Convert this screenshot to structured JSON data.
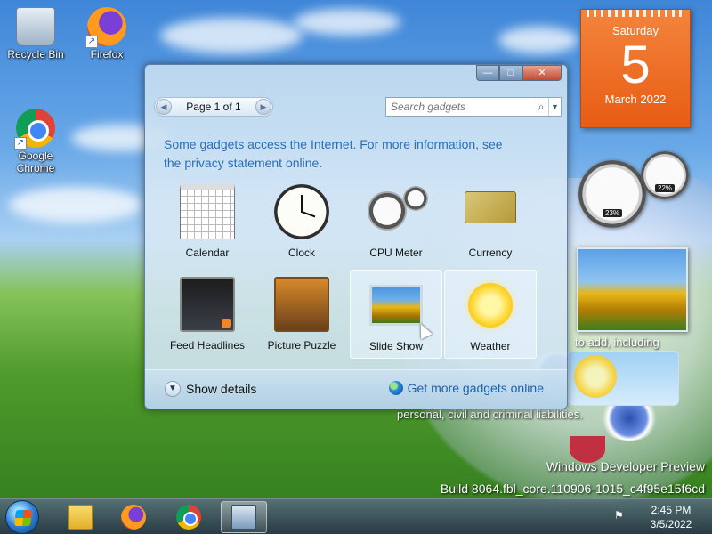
{
  "desktop": {
    "icons": [
      {
        "label": "Recycle Bin"
      },
      {
        "label": "Firefox"
      },
      {
        "label": "Google Chrome"
      }
    ],
    "overlay_text": {
      "line1": "to add, including",
      "line2": "personal, civil and criminal liabilities."
    },
    "watermark": {
      "line1": "Windows Developer Preview",
      "line2": "Build 8064.fbl_core.110906-1015_c4f95e15f6cd"
    }
  },
  "calendar_gadget": {
    "day_name": "Saturday",
    "day_number": "5",
    "month_year": "March 2022"
  },
  "cpu_meter_gadget": {
    "cpu_pct": "23%",
    "mem_pct": "22%"
  },
  "gallery": {
    "pager": {
      "text": "Page 1 of 1",
      "prev_icon": "chevron-left",
      "next_icon": "chevron-right"
    },
    "search": {
      "placeholder": "Search gadgets",
      "icon": "search-icon",
      "dropdown_icon": "chevron-down-icon"
    },
    "notice": {
      "text1": "Some gadgets access the Internet.  For more information, see",
      "text2": "the privacy statement online."
    },
    "gadgets": [
      {
        "label": "Calendar"
      },
      {
        "label": "Clock"
      },
      {
        "label": "CPU Meter"
      },
      {
        "label": "Currency"
      },
      {
        "label": "Feed Headlines"
      },
      {
        "label": "Picture Puzzle"
      },
      {
        "label": "Slide Show"
      },
      {
        "label": "Weather"
      }
    ],
    "details_label": "Show details",
    "get_more_label": "Get more gadgets online",
    "controls": {
      "minimize": "—",
      "maximize": "□",
      "close": "✕"
    }
  },
  "taskbar": {
    "items": [
      "Windows Explorer",
      "Firefox",
      "Google Chrome",
      "Gadgets"
    ],
    "clock_time": "2:45 PM",
    "clock_date": "3/5/2022"
  },
  "colors": {
    "accent_link": "#2a6fb7",
    "calendar_orange": "#e85c14"
  }
}
